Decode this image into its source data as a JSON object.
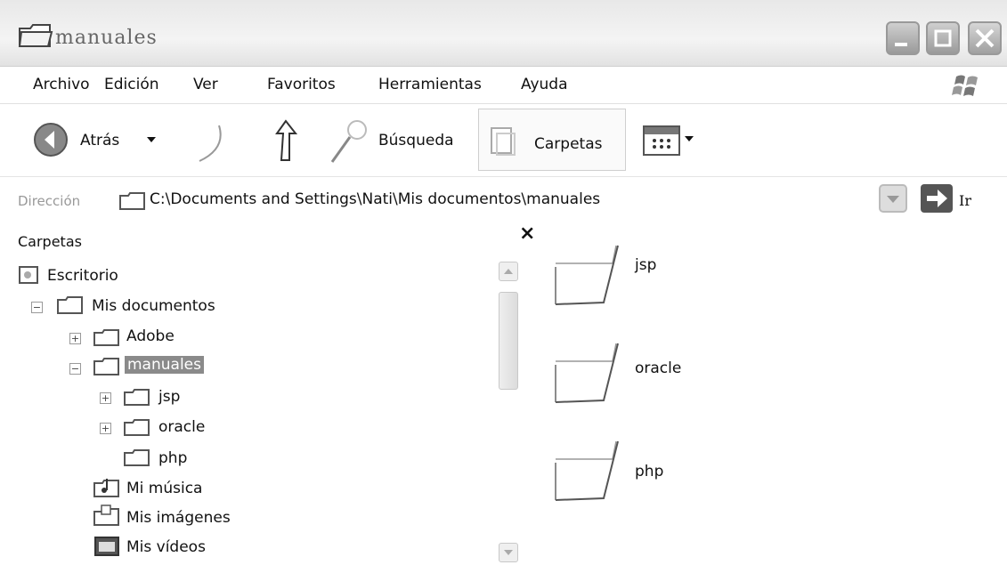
{
  "window": {
    "title": "manuales"
  },
  "menu": {
    "items": [
      "Archivo",
      "Edición",
      "Ver",
      "Favoritos",
      "Herramientas",
      "Ayuda"
    ]
  },
  "toolbar": {
    "back_label": "Atrás",
    "search_label": "Búsqueda",
    "folders_label": "Carpetas"
  },
  "address": {
    "label": "Dirección",
    "value": "C:\\Documents and Settings\\Nati\\Mis documentos\\manuales",
    "go_label": "Ir"
  },
  "folder_pane": {
    "title": "Carpetas",
    "close_glyph": "×",
    "tree": [
      {
        "label": "Escritorio"
      },
      {
        "label": "Mis documentos",
        "expander": "−"
      },
      {
        "label": "Adobe",
        "expander": "+"
      },
      {
        "label": "manuales",
        "expander": "−",
        "selected": true
      },
      {
        "label": "jsp",
        "expander": "+"
      },
      {
        "label": "oracle",
        "expander": "+"
      },
      {
        "label": "php"
      },
      {
        "label": "Mi música"
      },
      {
        "label": "Mis imágenes"
      },
      {
        "label": "Mis vídeos"
      }
    ]
  },
  "content": {
    "items": [
      "jsp",
      "oracle",
      "php"
    ]
  },
  "colors": {
    "selection": "#8a8a8a",
    "titlebar": "#e8e8e8"
  }
}
